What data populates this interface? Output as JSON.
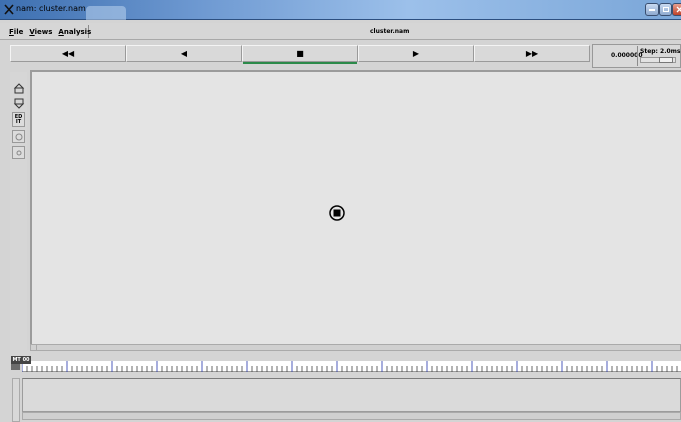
{
  "window": {
    "title": "nam: cluster.nam"
  },
  "menu": {
    "items": [
      "File",
      "Views",
      "Analysis"
    ],
    "filename": "cluster.nam"
  },
  "controls": {
    "rewind": "◀◀",
    "back": "◀",
    "stop": "■",
    "play": "▶",
    "fast_forward": "▶▶",
    "active": "stop"
  },
  "time": {
    "value": "0.000000",
    "step_label": "Step: 2.0ms"
  },
  "left_tools": {
    "edit_label": "ED IT"
  },
  "timeline": {
    "label": "MT 00"
  },
  "icons": {
    "app": "nam-icon",
    "zoom_in": "zoom-in-icon",
    "zoom_out": "zoom-out-icon",
    "node": "node-icon"
  },
  "colors": {
    "active_indicator": "#2c8a4a",
    "canvas_bg": "#e4e4e4",
    "title_bar": "#6f9ad2"
  }
}
